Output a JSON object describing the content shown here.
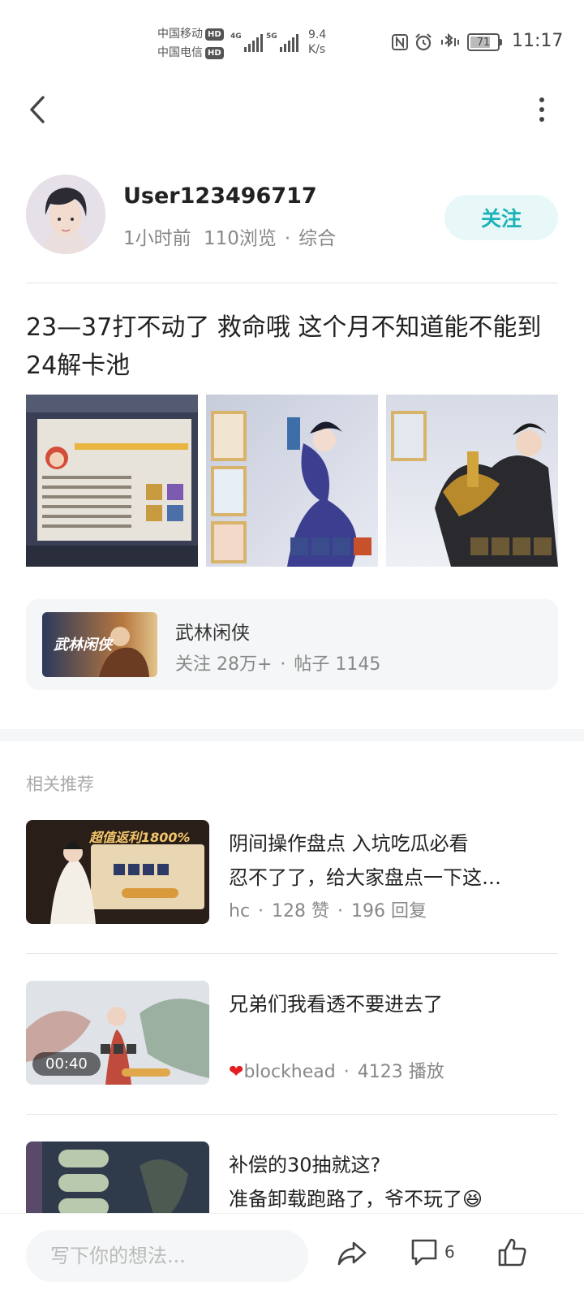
{
  "status_bar": {
    "carrier_1": "中国移动",
    "carrier_2": "中国电信",
    "hd_badge": "HD",
    "network_1": "4G",
    "network_2": "5G",
    "speed_value": "9.4",
    "speed_unit": "K/s",
    "battery_level": "71",
    "time": "11:17"
  },
  "author": {
    "name": "User123496717",
    "time_ago": "1小时前",
    "views": "110浏览",
    "category": "综合",
    "follow_label": "关注"
  },
  "post": {
    "title": "23—37打不动了 救命哦 这个月不知道能不能到24解卡池"
  },
  "game_card": {
    "logo_text": "武林闲侠",
    "name": "武林闲侠",
    "followers": "关注 28万+",
    "posts": "帖子 1145"
  },
  "related": {
    "section_title": "相关推荐",
    "items": [
      {
        "title_line1": "阴间操作盘点 入坑吃瓜必看",
        "title_line2": "忍不了了，给大家盘点一下这…",
        "author": "hc",
        "likes": "128 赞",
        "replies": "196 回复",
        "thumb_banner": "超值返利1800%"
      },
      {
        "title_line1": "兄弟们我看透不要进去了",
        "author": "blockhead",
        "plays": "4123 播放",
        "duration": "00:40"
      },
      {
        "title_line1": "补偿的30抽就这?",
        "title_line2": "准备卸载跑路了，爷不玩了😆"
      }
    ]
  },
  "bottom_bar": {
    "comment_placeholder": "写下你的想法...",
    "comment_count": "6"
  },
  "colors": {
    "accent": "#1bb3b8",
    "follow_bg": "#e8f7f8",
    "card_bg": "#f5f6f7",
    "muted_text": "#888888"
  }
}
